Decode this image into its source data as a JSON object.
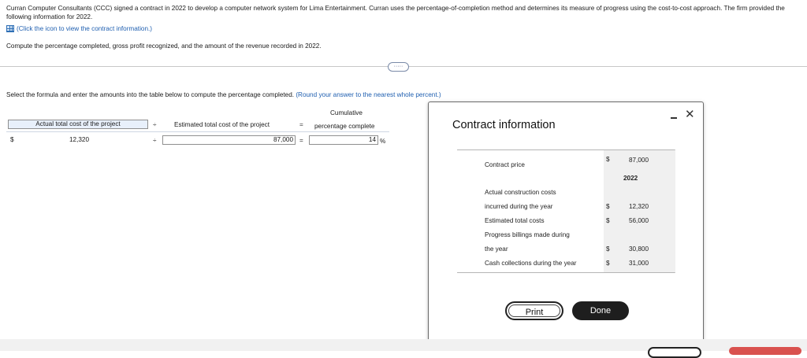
{
  "problem": {
    "intro": "Curran Computer Consultants (CCC) signed a contract in 2022 to develop a computer network system for Lima Entertainment. Curran uses the percentage-of-completion method and determines its measure of progress using the cost-to-cost approach. The firm provided the following information for 2022.",
    "link_text": "(Click the icon to view the contract information.)",
    "task": "Compute the percentage completed, gross profit recognized, and the amount of the revenue recorded in 2022.",
    "expand_label": "·····",
    "instruction": "Select the formula and enter the amounts into the table below to compute the percentage completed.",
    "instruction_hint": "(Round your answer to the nearest whole percent.)"
  },
  "formula": {
    "header_top": "Cumulative",
    "col1": "Actual total cost of the project",
    "op1": "÷",
    "col2": "Estimated total cost of the project",
    "op2": "=",
    "col3": "percentage complete",
    "currency": "$",
    "val1": "12,320",
    "val2": "87,000",
    "val3": "14",
    "percent": "%"
  },
  "modal": {
    "title": "Contract information",
    "year": "2022",
    "rows": {
      "contract_price": "Contract price",
      "contract_price_cur": "$",
      "contract_price_val": "87,000",
      "actual_costs_l1": "Actual construction costs",
      "actual_costs_l2": "incurred during the year",
      "actual_costs_cur": "$",
      "actual_costs_val": "12,320",
      "estimated": "Estimated total costs",
      "estimated_cur": "$",
      "estimated_val": "56,000",
      "billings_l1": "Progress billings made during",
      "billings_l2": "the year",
      "billings_cur": "$",
      "billings_val": "30,800",
      "collections": "Cash collections during the year",
      "collections_cur": "$",
      "collections_val": "31,000"
    },
    "print_label": "Print",
    "done_label": "Done",
    "close_glyph": "✕"
  }
}
